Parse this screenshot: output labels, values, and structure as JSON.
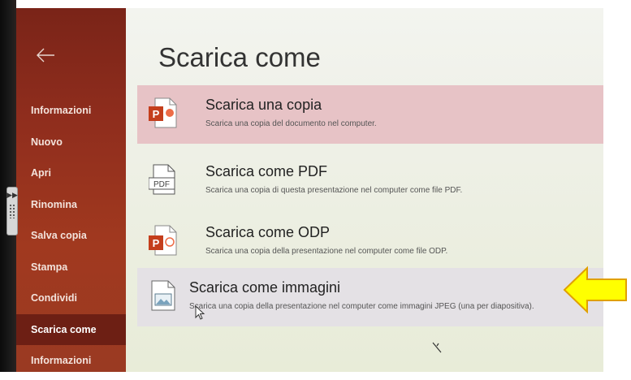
{
  "sidebar": {
    "back_icon": "arrow-left-icon",
    "items": [
      {
        "label": "Informazioni"
      },
      {
        "label": "Nuovo"
      },
      {
        "label": "Apri"
      },
      {
        "label": "Rinomina"
      },
      {
        "label": "Salva copia"
      },
      {
        "label": "Stampa"
      },
      {
        "label": "Condividi"
      },
      {
        "label": "Scarica come"
      },
      {
        "label": "Informazioni"
      }
    ],
    "active_index": 7,
    "color": "#8f2d1d"
  },
  "main": {
    "title": "Scarica come",
    "options": [
      {
        "title": "Scarica una copia",
        "description": "Scarica una copia del documento nel computer.",
        "icon": "powerpoint-file-icon",
        "badge": "P"
      },
      {
        "title": "Scarica come PDF",
        "description": "Scarica una copia di questa presentazione nel computer come file PDF.",
        "icon": "pdf-file-icon",
        "badge": "PDF"
      },
      {
        "title": "Scarica come ODP",
        "description": "Scarica una copia della presentazione nel computer come file ODP.",
        "icon": "odp-file-icon",
        "badge": "P"
      },
      {
        "title": "Scarica come immagini",
        "description": "Scarica una copia della presentazione nel computer come immagini JPEG (una per diapositiva).",
        "icon": "image-file-icon"
      }
    ]
  },
  "annotation": {
    "arrow_color": "#ffff00",
    "arrow_icon": "yellow-arrow-left-icon"
  }
}
